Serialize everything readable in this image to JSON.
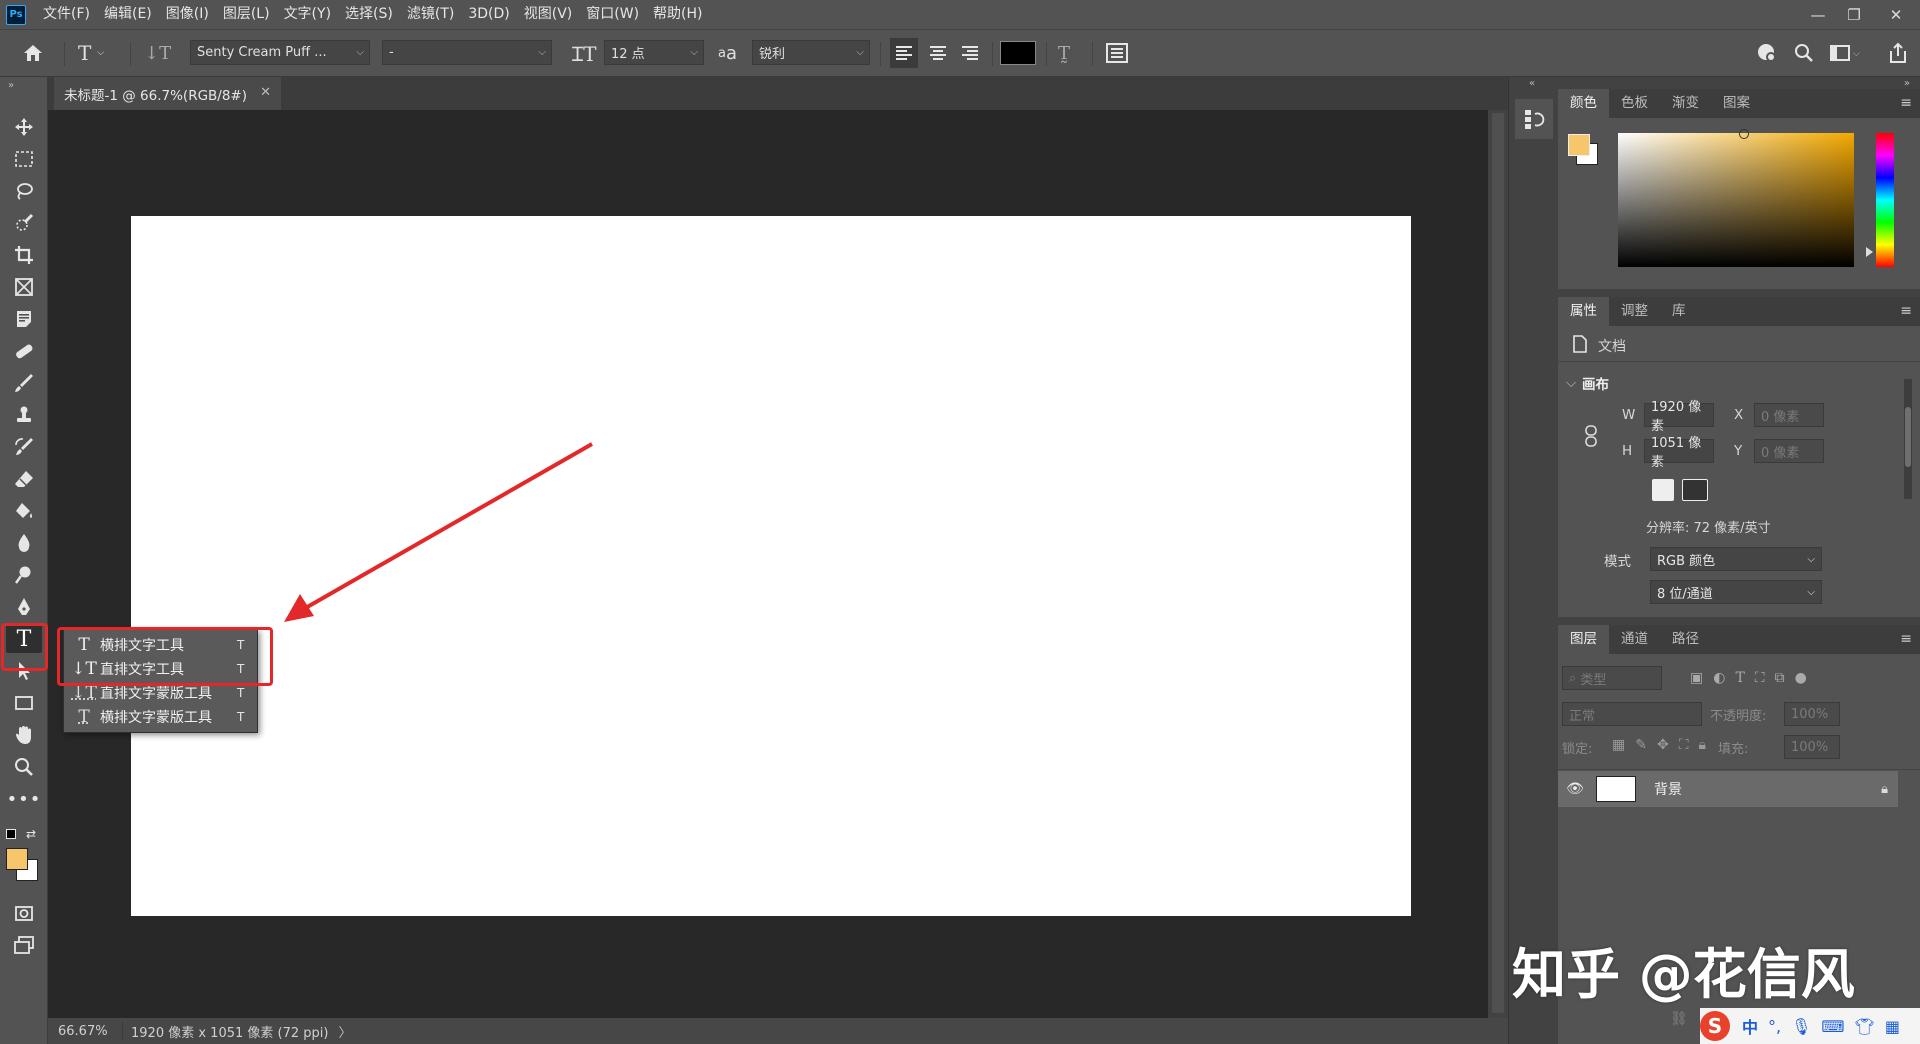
{
  "app": {
    "logo": "Ps"
  },
  "menu": [
    "文件(F)",
    "编辑(E)",
    "图像(I)",
    "图层(L)",
    "文字(Y)",
    "选择(S)",
    "滤镜(T)",
    "3D(D)",
    "视图(V)",
    "窗口(W)",
    "帮助(H)"
  ],
  "window_controls": {
    "minimize": "—",
    "restore": "❐",
    "close": "✕"
  },
  "options": {
    "font_family": "Senty Cream Puff ...",
    "font_style": "-",
    "font_size": "12 点",
    "aa_glyph": "a",
    "antialias": "锐利",
    "text_color": "#000000"
  },
  "document": {
    "tab_title": "未标题-1 @ 66.7%(RGB/8#)",
    "zoom": "66.67%",
    "size_info": "1920 像素 x 1051 像素 (72 ppi)",
    "status_chevron": "〉"
  },
  "flyout": {
    "items": [
      {
        "label": "横排文字工具",
        "key": "T"
      },
      {
        "label": "直排文字工具",
        "key": "T"
      },
      {
        "label": "直排文字蒙版工具",
        "key": "T"
      },
      {
        "label": "横排文字蒙版工具",
        "key": "T"
      }
    ]
  },
  "colors": {
    "foreground": "#f6c76a",
    "background": "#ffffff",
    "accent_red": "#e4282a",
    "picker_hue": "#f3a800"
  },
  "color_panel": {
    "tabs": [
      "颜色",
      "色板",
      "渐变",
      "图案"
    ]
  },
  "properties_panel": {
    "tabs": [
      "属性",
      "调整",
      "库"
    ],
    "doc_label": "文档",
    "section": "画布",
    "w_label": "W",
    "w_value": "1920 像素",
    "h_label": "H",
    "h_value": "1051 像素",
    "x_label": "X",
    "x_placeholder": "0 像素",
    "y_label": "Y",
    "y_placeholder": "0 像素",
    "resolution": "分辨率: 72 像素/英寸",
    "mode_label": "模式",
    "mode_value": "RGB 颜色",
    "depth_value": "8 位/通道"
  },
  "layers_panel": {
    "tabs": [
      "图层",
      "通道",
      "路径"
    ],
    "filter_placeholder": "类型",
    "blend_mode": "正常",
    "opacity_label": "不透明度:",
    "opacity_value": "100%",
    "lock_label": "锁定:",
    "fill_label": "填充:",
    "fill_value": "100%",
    "layer_name": "背景"
  },
  "watermark": "知乎 @花信风",
  "ime": {
    "brand": "S",
    "lang": "中",
    "punct": "°,"
  }
}
